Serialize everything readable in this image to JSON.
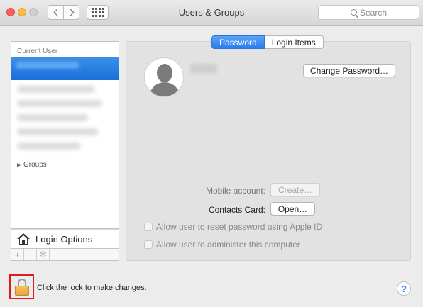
{
  "window": {
    "title": "Users & Groups",
    "search_placeholder": "Search"
  },
  "sidebar": {
    "header": "Current User",
    "groups_label": "Groups",
    "login_options_label": "Login Options",
    "toolbar": {
      "add": "+",
      "remove": "−",
      "action": "✻"
    }
  },
  "tabs": [
    {
      "label": "Password",
      "active": true
    },
    {
      "label": "Login Items",
      "active": false
    }
  ],
  "main": {
    "change_password_label": "Change Password…",
    "mobile_account_label": "Mobile account:",
    "mobile_account_button": "Create…",
    "contacts_card_label": "Contacts Card:",
    "contacts_card_button": "Open…",
    "allow_reset_label": "Allow user to reset password using Apple ID",
    "allow_admin_label": "Allow user to administer this computer"
  },
  "footer": {
    "lock_text": "Click the lock to make changes.",
    "help": "?"
  },
  "colors": {
    "accent": "#2a7cf0",
    "highlight_box": "#e01b1b",
    "lock": "#f0b24a"
  }
}
